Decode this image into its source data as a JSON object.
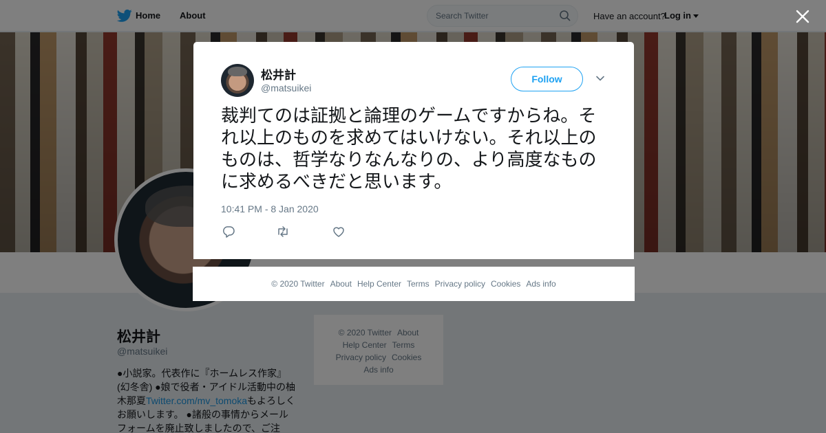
{
  "nav": {
    "home": "Home",
    "about": "About",
    "search_placeholder": "Search Twitter",
    "have_account": "Have an account?",
    "login": "Log in"
  },
  "profile": {
    "name": "松井計",
    "handle": "@matsuikei",
    "bio_1": "●小説家。代表作に『ホームレス作家』(幻冬舎) ●娘で役者・アイドル活動中の柚木那夏",
    "bio_link": "Twitter.com/mv_tomoka",
    "bio_2": "もよろしくお願いします。 ●諸般の事情からメールフォームを廃止致しましたので、ご注"
  },
  "page_footer": {
    "copyright": "© 2020 Twitter",
    "about": "About",
    "help": "Help Center",
    "terms": "Terms",
    "privacy": "Privacy policy",
    "cookies": "Cookies",
    "ads": "Ads info"
  },
  "tweet": {
    "name": "松井計",
    "handle": "@matsuikei",
    "follow_label": "Follow",
    "text": "裁判てのは証拠と論理のゲームですからね。それ以上のものを求めてはいけない。それ以上のものは、哲学なりなんなりの、より高度なものに求めるべきだと思います。",
    "timestamp": "10:41 PM - 8 Jan 2020"
  },
  "modal_footer": {
    "copyright": "© 2020 Twitter",
    "about": "About",
    "help": "Help Center",
    "terms": "Terms",
    "privacy": "Privacy policy",
    "cookies": "Cookies",
    "ads": "Ads info"
  },
  "colors": {
    "accent": "#1da1f2",
    "text": "#14171a",
    "muted": "#657786"
  }
}
